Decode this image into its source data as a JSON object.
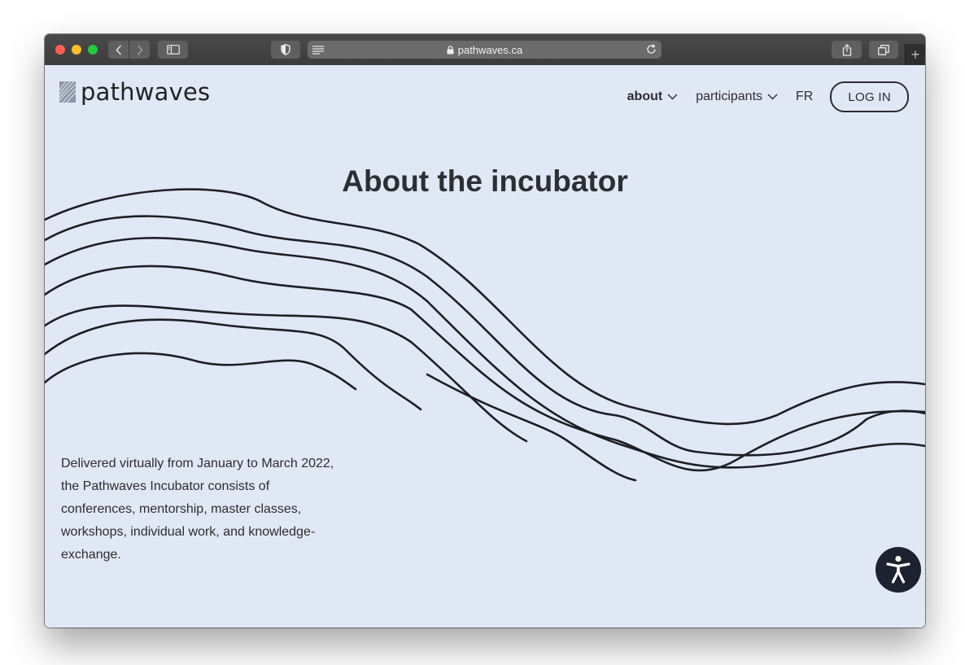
{
  "browser": {
    "url": "pathwaves.ca",
    "icons": [
      "back-arrow-icon",
      "forward-arrow-icon",
      "sidebar-icon",
      "privacy-shield-icon",
      "reader-icon",
      "lock-icon",
      "reload-icon",
      "share-icon",
      "tabs-icon",
      "new-tab-plus-icon"
    ]
  },
  "site": {
    "logo_text": "pathwaves",
    "nav": {
      "about": "about",
      "participants": "participants",
      "language": "FR",
      "login": "LOG IN"
    },
    "title": "About the incubator",
    "intro": "Delivered virtually from January to March 2022, the Pathwaves Incubator consists of conferences, mentorship, master classes, workshops, individual work, and knowledge-exchange."
  },
  "colors": {
    "page_background": "#e1e8f5",
    "text": "#2a2d31",
    "accessibility_button": "#1d2230"
  }
}
